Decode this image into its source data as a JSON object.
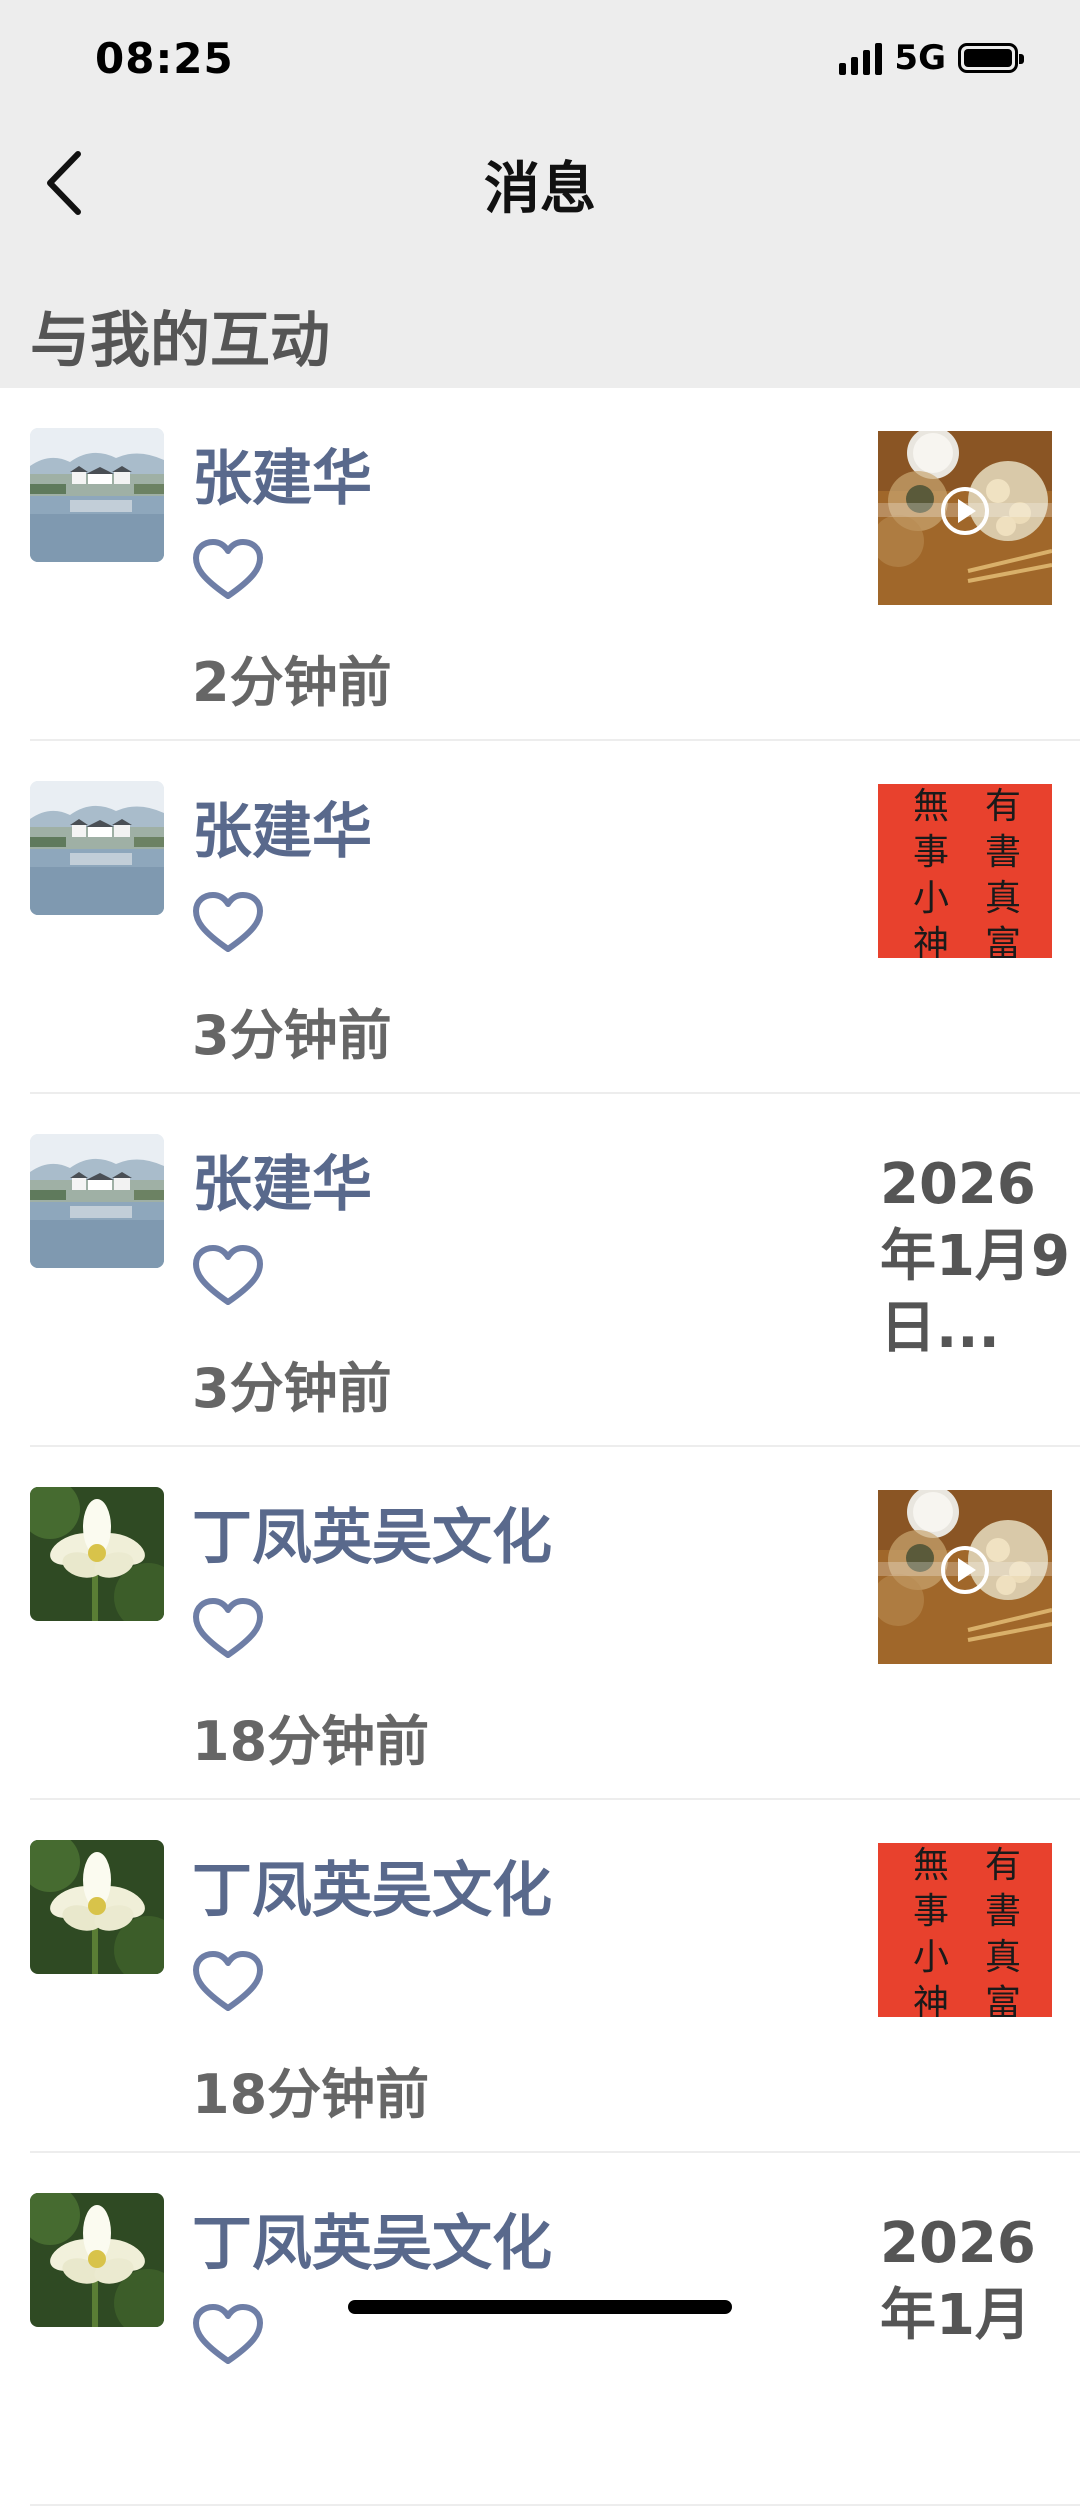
{
  "status_bar": {
    "time": "08:25",
    "network": "5G"
  },
  "nav": {
    "title": "消息"
  },
  "section": {
    "title": "与我的互动"
  },
  "items": [
    {
      "name": "张建华",
      "time": "2分钟前",
      "avatar": "landscape-avatar",
      "preview": "food-video-thumb",
      "preview_text": ""
    },
    {
      "name": "张建华",
      "time": "3分钟前",
      "avatar": "landscape-avatar",
      "preview": "calligraphy-thumb",
      "preview_text": ""
    },
    {
      "name": "张建华",
      "time": "3分钟前",
      "avatar": "landscape-avatar",
      "preview": "text",
      "preview_text": "2026年1月9日..."
    },
    {
      "name": "丁凤英吴文化",
      "time": "18分钟前",
      "avatar": "lotus-avatar",
      "preview": "food-video-thumb",
      "preview_text": ""
    },
    {
      "name": "丁凤英吴文化",
      "time": "18分钟前",
      "avatar": "lotus-avatar",
      "preview": "calligraphy-thumb",
      "preview_text": ""
    },
    {
      "name": "丁凤英吴文化",
      "time": "",
      "avatar": "lotus-avatar",
      "preview": "text",
      "preview_text": "2026年1月"
    }
  ],
  "calligraphy": {
    "col1": "無事小神",
    "col2": "有書真富"
  },
  "colors": {
    "name_blue": "#59698c",
    "heart": "#6e7ea6",
    "background_gray": "#ededed"
  },
  "icons": {
    "back": "chevron-left-icon",
    "like": "heart-outline-icon"
  }
}
